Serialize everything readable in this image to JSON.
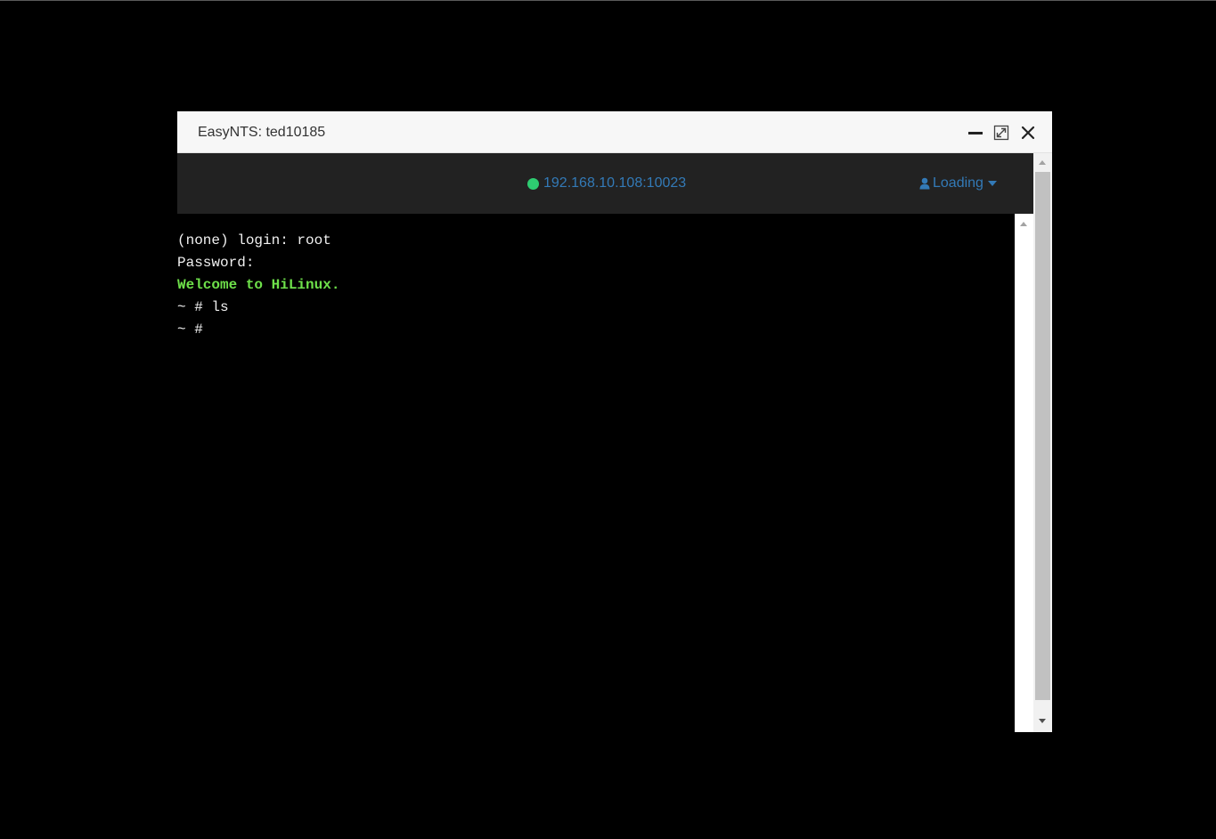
{
  "window": {
    "title": "EasyNTS: ted10185"
  },
  "navbar": {
    "connection_address": "192.168.10.108:10023",
    "user_menu_label": "Loading"
  },
  "terminal": {
    "lines": [
      "(none) login: root",
      "Password:",
      "Welcome to HiLinux.",
      "~ # ls",
      "~ #"
    ]
  },
  "icons": {
    "minimize": "minimize-icon",
    "maximize": "maximize-icon",
    "close": "close-icon",
    "status": "status-dot-icon",
    "user": "user-icon",
    "dropdown": "caret-down-icon"
  },
  "colors": {
    "title_bar": "#f7f7f7",
    "navbar": "#222222",
    "link": "#337ab7",
    "status_online": "#2ecc71",
    "terminal_bg": "#000000",
    "terminal_text": "#f0f0f0",
    "terminal_highlight": "#6ee04a"
  }
}
